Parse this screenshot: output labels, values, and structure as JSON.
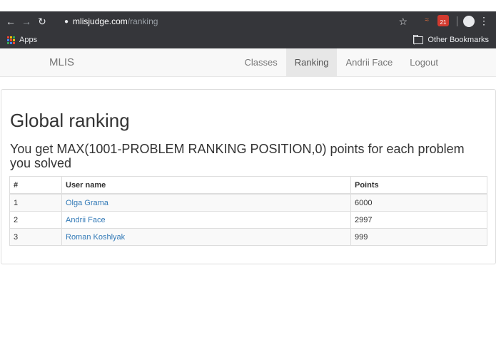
{
  "browser": {
    "url_host": "mlisjudge.com",
    "url_path": "/ranking",
    "extension_badge": "21",
    "bookmarks": {
      "apps_label": "Apps",
      "other_label": "Other Bookmarks"
    }
  },
  "site_nav": {
    "brand": "MLIS",
    "items": [
      {
        "label": "Classes",
        "active": false
      },
      {
        "label": "Ranking",
        "active": true
      },
      {
        "label": "Andrii Face",
        "active": false
      },
      {
        "label": "Logout",
        "active": false
      }
    ]
  },
  "main": {
    "title": "Global ranking",
    "description": "You get MAX(1001-PROBLEM RANKING POSITION,0) points for each problem you solved",
    "table": {
      "headers": [
        "#",
        "User name",
        "Points"
      ],
      "rows": [
        {
          "rank": "1",
          "user": "Olga Grama",
          "points": "6000"
        },
        {
          "rank": "2",
          "user": "Andrii Face",
          "points": "2997"
        },
        {
          "rank": "3",
          "user": "Roman Koshlyak",
          "points": "999"
        }
      ]
    }
  },
  "colors": {
    "chrome_bg": "#35363a",
    "link": "#337ab7",
    "navbar_bg": "#f8f8f8",
    "active_nav_bg": "#e7e7e7"
  }
}
